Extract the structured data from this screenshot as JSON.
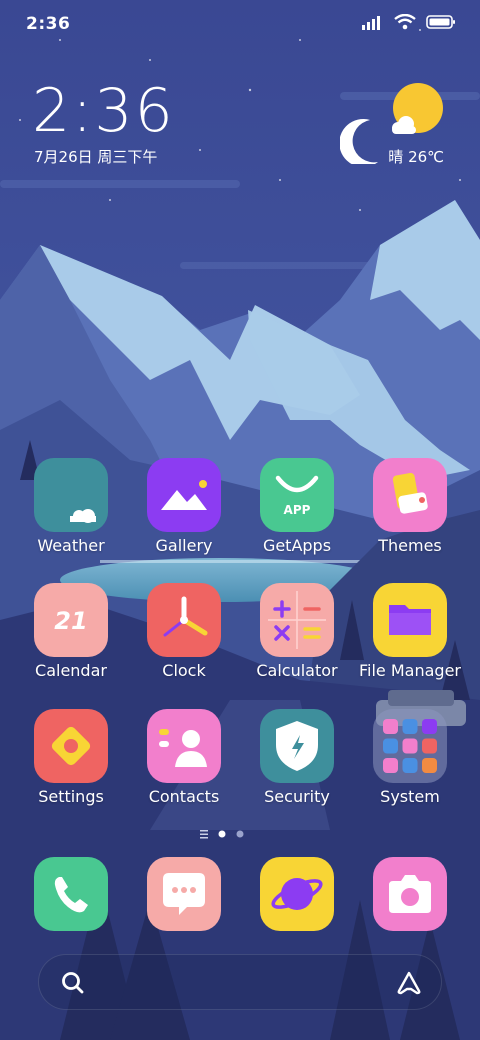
{
  "status_bar": {
    "time": "2:36"
  },
  "clock_widget": {
    "time": "2:36",
    "date": "7月26日 周三下午",
    "weather": "晴 26℃"
  },
  "apps": [
    {
      "label": "Weather"
    },
    {
      "label": "Gallery"
    },
    {
      "label": "GetApps"
    },
    {
      "label": "Themes"
    },
    {
      "label": "Calendar"
    },
    {
      "label": "Clock"
    },
    {
      "label": "Calculator"
    },
    {
      "label": "File Manager"
    },
    {
      "label": "Settings"
    },
    {
      "label": "Contacts"
    },
    {
      "label": "Security"
    },
    {
      "label": "System"
    }
  ],
  "icon_text": {
    "getapps": "APP",
    "calendar_day": "21"
  },
  "dock": [
    "phone-icon",
    "messages-icon",
    "browser-icon",
    "camera-icon"
  ],
  "page_indicator": {
    "pages": 2,
    "current": 1
  },
  "colors": {
    "sky": "#3d4d9a",
    "mountain_snow": "#a9cbe9",
    "weather": "#3e8f9c",
    "gallery": "#8c3cf2",
    "getapps": "#49c891",
    "themes": "#f27fcc",
    "calendar": "#f6aaa8",
    "clock": "#ef6462",
    "calculator": "#f6aaa8",
    "file_manager": "#f8d535",
    "settings": "#ef6462",
    "contacts": "#f27fcc",
    "security": "#3e8f9c",
    "phone": "#49c891",
    "messages": "#f6aaa8",
    "browser": "#f8d535",
    "camera": "#f27fcc"
  }
}
